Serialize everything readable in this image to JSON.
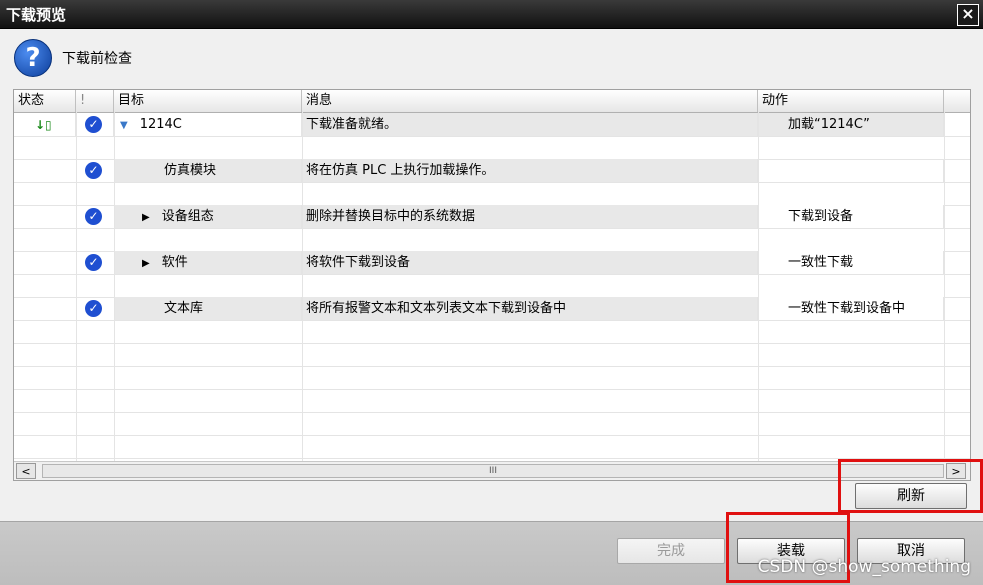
{
  "window": {
    "title": "下载预览",
    "close_label": "×"
  },
  "header": {
    "title": "下载前检查",
    "icon": "question-icon"
  },
  "table": {
    "columns": [
      "状态",
      "!",
      "目标",
      "消息",
      "动作"
    ],
    "rows": [
      {
        "target": "1214C",
        "message": "下载准备就绪。",
        "action": "加载“1214C”",
        "expand": "down",
        "status_icon": "download-status-icon"
      },
      {
        "target": "仿真模块",
        "message": "将在仿真 PLC 上执行加载操作。",
        "action": "",
        "expand": "none"
      },
      {
        "target": "设备组态",
        "message": "删除并替换目标中的系统数据",
        "action": "下载到设备",
        "expand": "right"
      },
      {
        "target": "软件",
        "message": "将软件下载到设备",
        "action": "一致性下载",
        "expand": "right"
      },
      {
        "target": "文本库",
        "message": "将所有报警文本和文本列表文本下载到设备中",
        "action": "一致性下载到设备中",
        "expand": "none"
      }
    ],
    "scroll_thumb_label": "III"
  },
  "buttons": {
    "refresh": "刷新",
    "finish": "完成",
    "load": "装载",
    "cancel": "取消"
  },
  "watermark": "CSDN @show_something",
  "colors": {
    "highlight": "#e01010",
    "check": "#1f4fd1"
  }
}
